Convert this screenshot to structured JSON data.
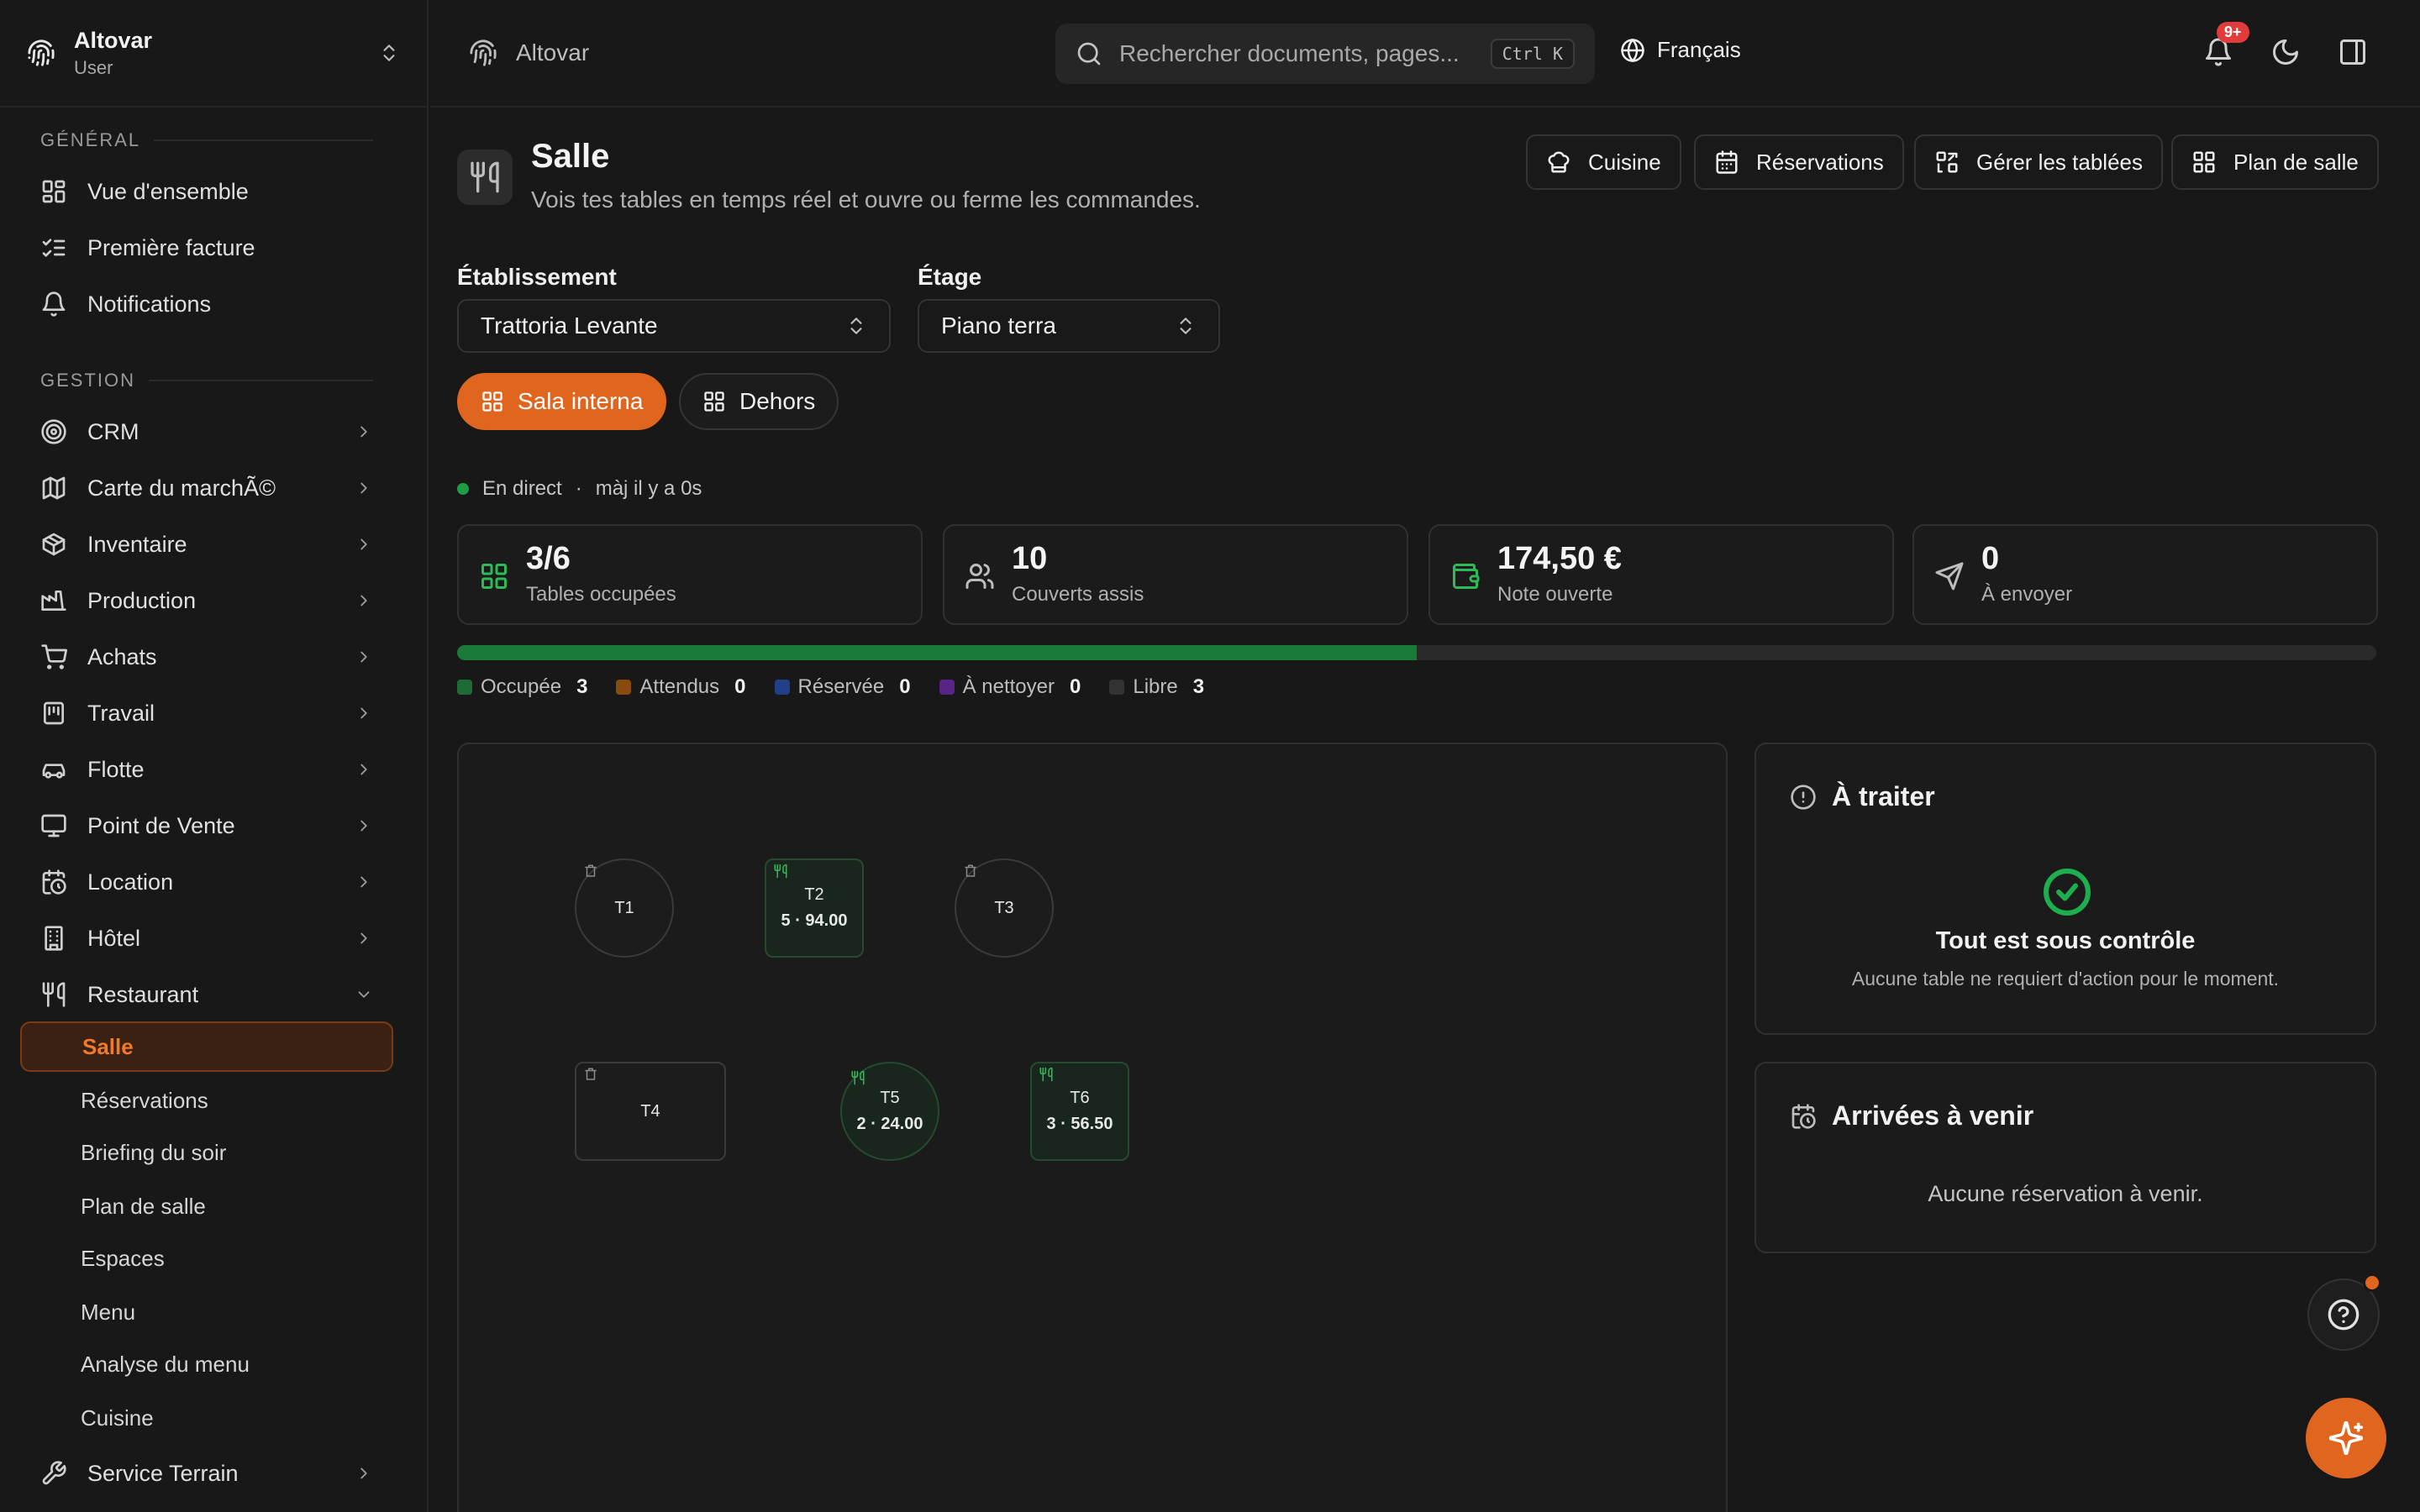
{
  "sidebar": {
    "org_name": "Altovar",
    "org_role": "User",
    "section_general": "GÉNÉRAL",
    "section_gestion": "GESTION",
    "general_items": [
      {
        "label": "Vue d'ensemble",
        "icon": "grid-icon"
      },
      {
        "label": "Première facture",
        "icon": "checklist-icon"
      },
      {
        "label": "Notifications",
        "icon": "bell-icon"
      }
    ],
    "gestion_items": [
      {
        "label": "CRM",
        "icon": "target-icon"
      },
      {
        "label": "Carte du marchÃ©",
        "icon": "map-icon"
      },
      {
        "label": "Inventaire",
        "icon": "box-icon"
      },
      {
        "label": "Production",
        "icon": "factory-icon"
      },
      {
        "label": "Achats",
        "icon": "cart-icon"
      },
      {
        "label": "Travail",
        "icon": "clipboard-icon"
      },
      {
        "label": "Flotte",
        "icon": "car-icon"
      },
      {
        "label": "Point de Vente",
        "icon": "monitor-icon"
      },
      {
        "label": "Location",
        "icon": "calendar-clock-icon"
      },
      {
        "label": "Hôtel",
        "icon": "building-icon"
      },
      {
        "label": "Restaurant",
        "icon": "utensils-icon"
      }
    ],
    "restaurant_sub": [
      "Salle",
      "Réservations",
      "Briefing du soir",
      "Plan de salle",
      "Espaces",
      "Menu",
      "Analyse du menu",
      "Cuisine"
    ],
    "last_item": {
      "label": "Service Terrain",
      "icon": "wrench-icon"
    }
  },
  "topbar": {
    "breadcrumb": "Altovar",
    "search_placeholder": "Rechercher documents, pages...",
    "search_shortcut": "Ctrl K",
    "language": "Français",
    "notif_badge": "9+"
  },
  "page": {
    "title": "Salle",
    "subtitle": "Vois tes tables en temps réel et ouvre ou ferme les commandes.",
    "actions": [
      "Cuisine",
      "Réservations",
      "Gérer les tablées",
      "Plan de salle"
    ]
  },
  "filters": {
    "establishment_label": "Établissement",
    "establishment_value": "Trattoria Levante",
    "floor_label": "Étage",
    "floor_value": "Piano terra",
    "zones": [
      "Sala interna",
      "Dehors"
    ],
    "active_zone": "Sala interna"
  },
  "live": {
    "status": "En direct",
    "updated": "màj il y a 0s"
  },
  "stats": [
    {
      "value": "3/6",
      "label": "Tables occupées"
    },
    {
      "value": "10",
      "label": "Couverts assis"
    },
    {
      "value": "174,50 €",
      "label": "Note ouverte"
    },
    {
      "value": "0",
      "label": "À envoyer"
    }
  ],
  "occupancy_fraction": 0.5,
  "legend": [
    {
      "label": "Occupée",
      "count": "3",
      "color": "#1f6b35"
    },
    {
      "label": "Attendus",
      "count": "0",
      "color": "#8a4a0e"
    },
    {
      "label": "Réservée",
      "count": "0",
      "color": "#22408a"
    },
    {
      "label": "À nettoyer",
      "count": "0",
      "color": "#5a2386"
    },
    {
      "label": "Libre",
      "count": "3",
      "color": "#333333"
    }
  ],
  "tables": [
    {
      "name": "T1",
      "info": ""
    },
    {
      "name": "T2",
      "info": "5 · 94.00"
    },
    {
      "name": "T3",
      "info": ""
    },
    {
      "name": "T4",
      "info": ""
    },
    {
      "name": "T5",
      "info": "2 · 24.00"
    },
    {
      "name": "T6",
      "info": "3 · 56.50"
    }
  ],
  "todo": {
    "title": "À traiter",
    "ok_title": "Tout est sous contrôle",
    "ok_text": "Aucune table ne requiert d'action pour le moment."
  },
  "arrivals": {
    "title": "Arrivées à venir",
    "empty": "Aucune réservation à venir."
  }
}
